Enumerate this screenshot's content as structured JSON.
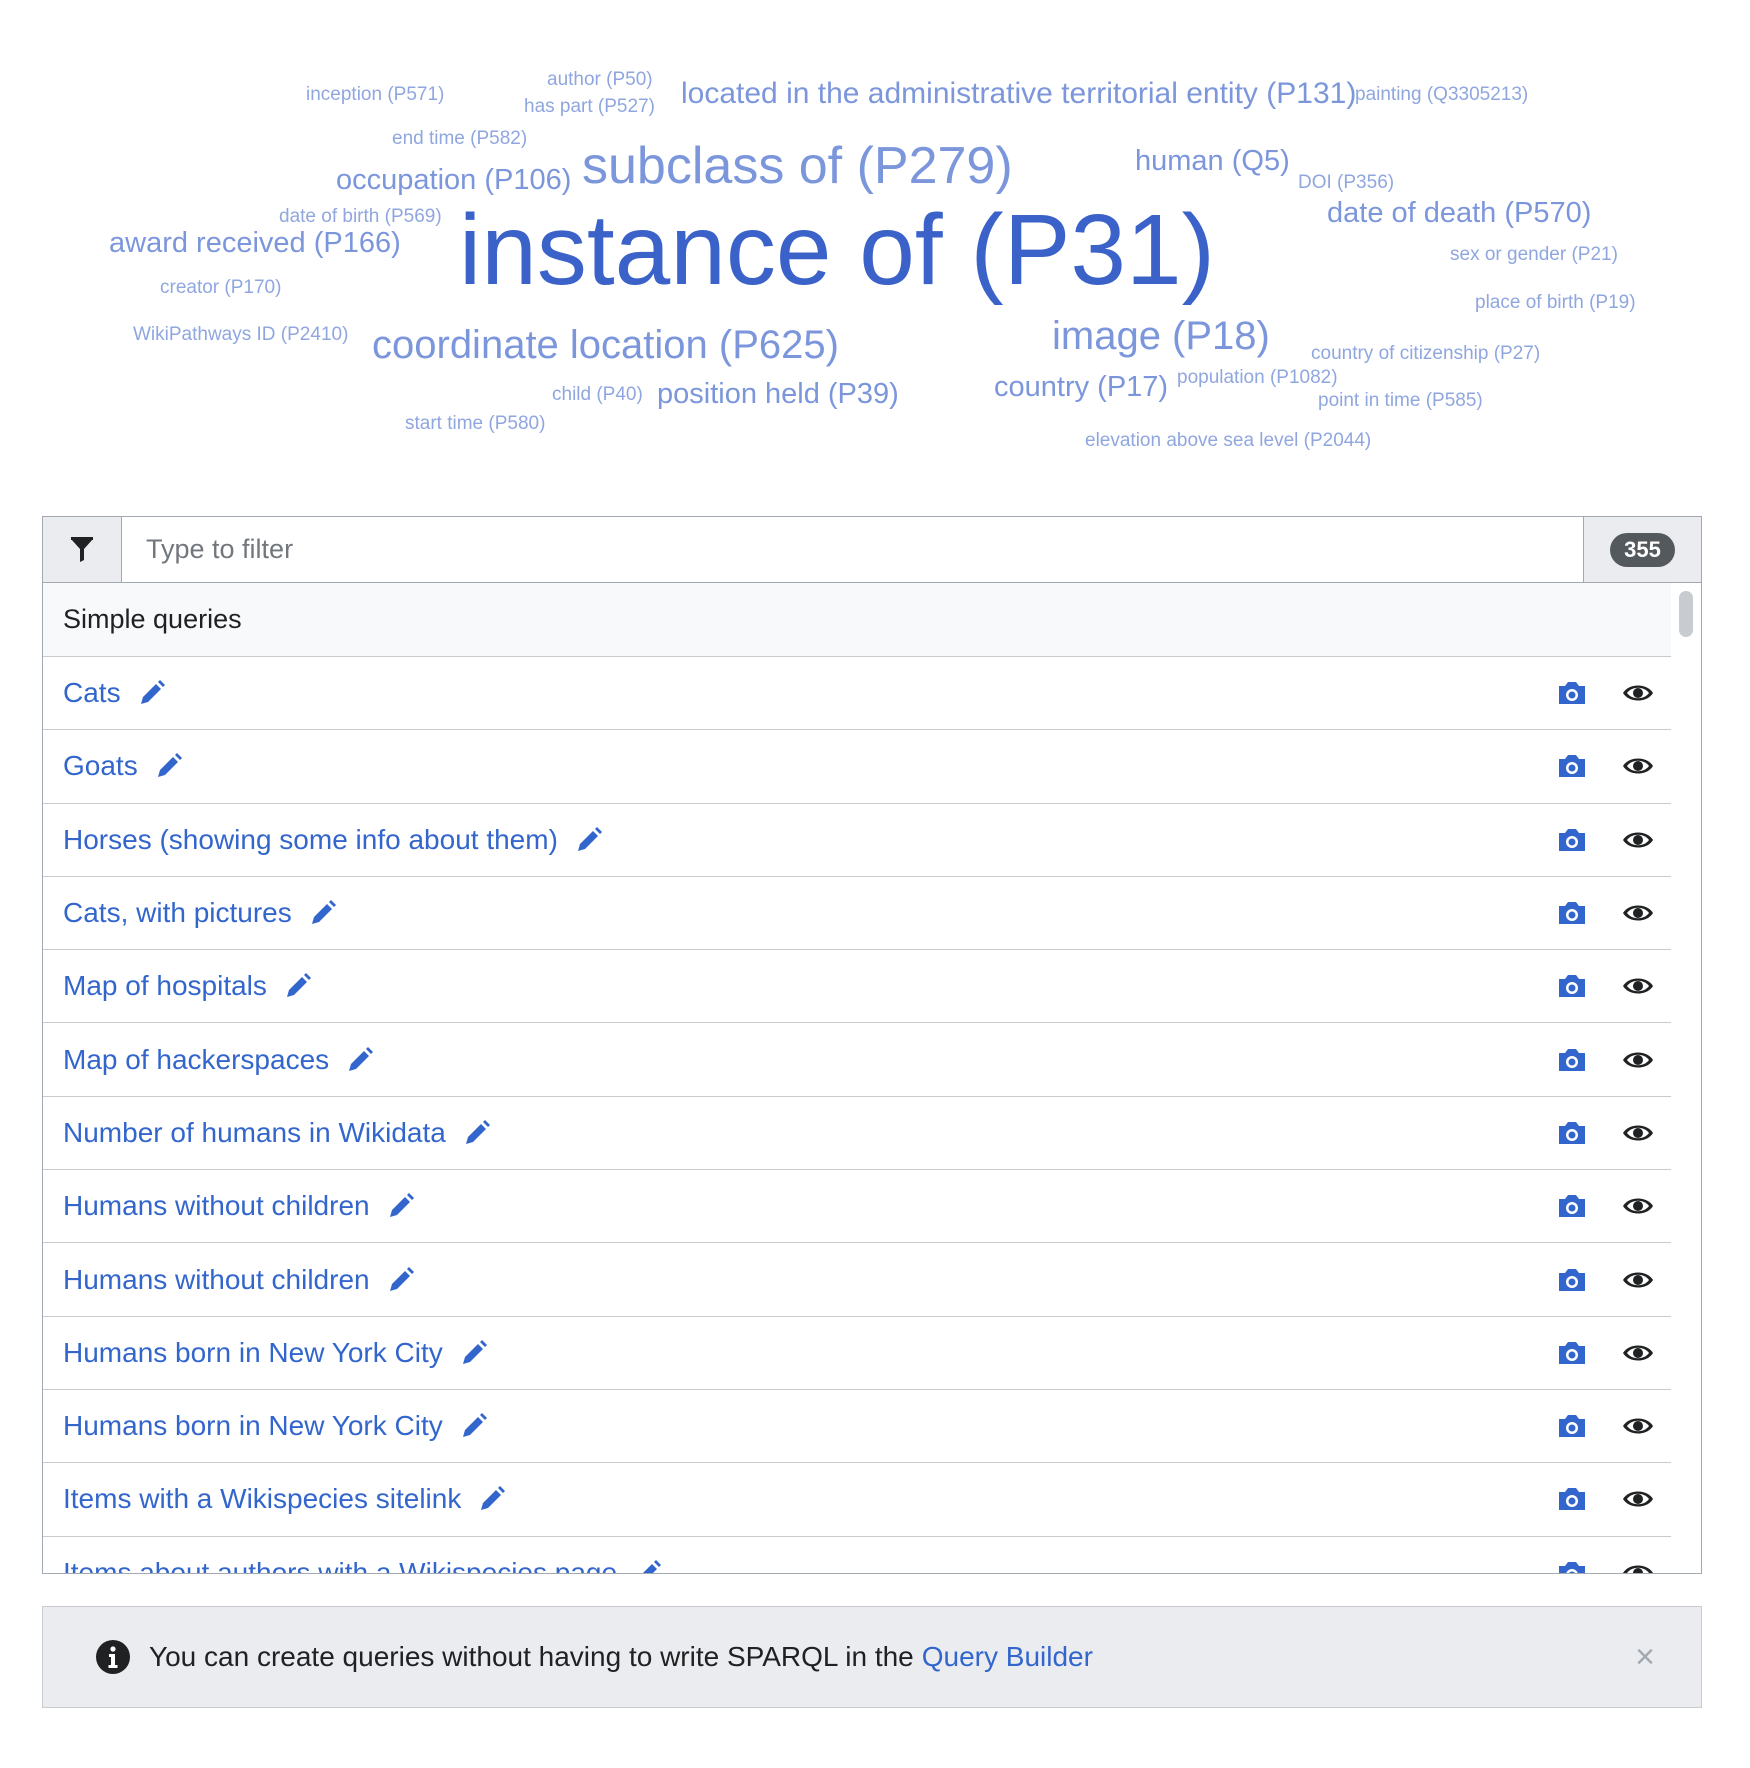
{
  "cloud": {
    "words": [
      {
        "text": "inception (P571)",
        "size": "xs"
      },
      {
        "text": "author (P50)",
        "size": "xs"
      },
      {
        "text": "has part (P527)",
        "size": "xs"
      },
      {
        "text": "located in the administrative territorial entity (P131)",
        "size": "m"
      },
      {
        "text": "painting (Q3305213)",
        "size": "xs"
      },
      {
        "text": "end time (P582)",
        "size": "xs"
      },
      {
        "text": "occupation (P106)",
        "size": "m"
      },
      {
        "text": "subclass of (P279)",
        "size": "xl"
      },
      {
        "text": "human (Q5)",
        "size": "m"
      },
      {
        "text": "DOI (P356)",
        "size": "xs"
      },
      {
        "text": "date of death (P570)",
        "size": "m"
      },
      {
        "text": "date of birth (P569)",
        "size": "xs"
      },
      {
        "text": "award received (P166)",
        "size": "m"
      },
      {
        "text": "instance of (P31)",
        "size": "xxl"
      },
      {
        "text": "sex or gender (P21)",
        "size": "xs"
      },
      {
        "text": "creator (P170)",
        "size": "xs"
      },
      {
        "text": "place of birth (P19)",
        "size": "xs"
      },
      {
        "text": "WikiPathways ID (P2410)",
        "size": "xs"
      },
      {
        "text": "coordinate location (P625)",
        "size": "l"
      },
      {
        "text": "image (P18)",
        "size": "l"
      },
      {
        "text": "country of citizenship (P27)",
        "size": "xs"
      },
      {
        "text": "child (P40)",
        "size": "xs"
      },
      {
        "text": "position held (P39)",
        "size": "m"
      },
      {
        "text": "country (P17)",
        "size": "m"
      },
      {
        "text": "population (P1082)",
        "size": "xs"
      },
      {
        "text": "point in time (P585)",
        "size": "xs"
      },
      {
        "text": "start time (P580)",
        "size": "xs"
      },
      {
        "text": "elevation above sea level (P2044)",
        "size": "xs"
      }
    ]
  },
  "filter": {
    "placeholder": "Type to filter",
    "count": "355"
  },
  "section": {
    "title": "Simple queries"
  },
  "queries": [
    "Cats",
    "Goats",
    "Horses (showing some info about them)",
    "Cats, with pictures",
    "Map of hospitals",
    "Map of hackerspaces",
    "Number of humans in Wikidata",
    "Humans without children",
    "Humans without children",
    "Humans born in New York City",
    "Humans born in New York City",
    "Items with a Wikispecies sitelink",
    "Items about authors with a Wikispecies page"
  ],
  "notice": {
    "text": "You can create queries without having to write SPARQL in the",
    "link": "Query Builder",
    "close": "×"
  },
  "icons": {
    "filter": "filter-icon",
    "edit": "pencil-icon",
    "preview": "camera-icon",
    "view": "eye-icon",
    "info": "info-icon"
  },
  "colors": {
    "link": "#3366cc",
    "cloud_large": "#3b62c8",
    "cloud_light": "#8fa6df"
  }
}
